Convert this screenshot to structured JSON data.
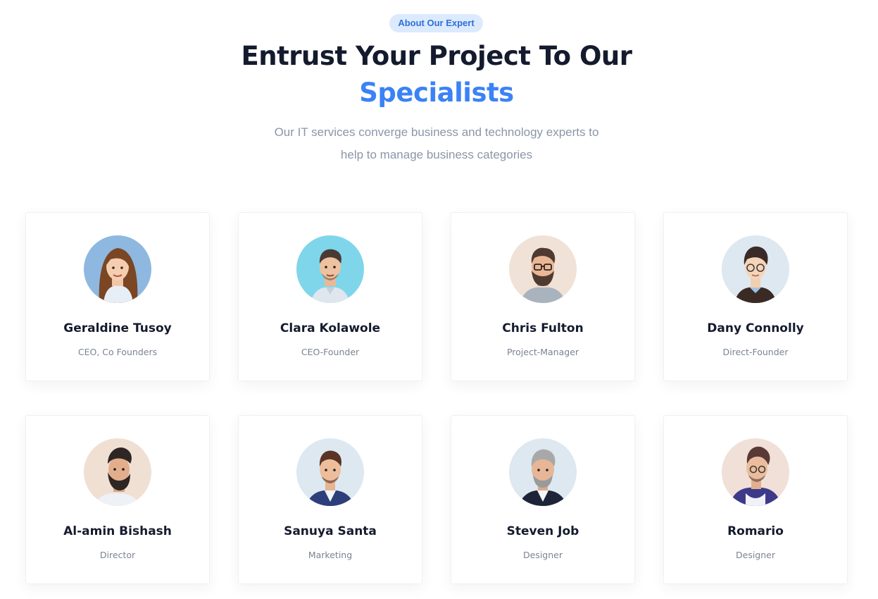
{
  "section": {
    "badge": "About Our Expert",
    "heading_line1": "Entrust Your Project To Our",
    "heading_line2": "Specialists",
    "subtitle_line1": "Our IT services converge business and technology experts to",
    "subtitle_line2": "help to manage business categories"
  },
  "colors": {
    "accent": "#3b82f6",
    "heading": "#151b2e",
    "muted": "#8b96a8",
    "badge_bg": "#dceafe"
  },
  "team": [
    {
      "name": "Geraldine Tusoy",
      "role": "CEO, Co Founders",
      "avatar_icon": "woman-long-hair-avatar",
      "avatar_bg": "#8fb8e0"
    },
    {
      "name": "Clara Kolawole",
      "role": "CEO-Founder",
      "avatar_icon": "man-shirt-avatar",
      "avatar_bg": "#7fd6ea"
    },
    {
      "name": "Chris Fulton",
      "role": "Project-Manager",
      "avatar_icon": "man-glasses-beard-avatar",
      "avatar_bg": "#f0e2d6"
    },
    {
      "name": "Dany Connolly",
      "role": "Direct-Founder",
      "avatar_icon": "man-glasses-sweater-avatar",
      "avatar_bg": "#dde8f0"
    },
    {
      "name": "Al-amin Bishash",
      "role": "Director",
      "avatar_icon": "man-beard-profile-avatar",
      "avatar_bg": "#f0e0d4"
    },
    {
      "name": "Sanuya Santa",
      "role": "Marketing",
      "avatar_icon": "man-suit-avatar",
      "avatar_bg": "#dde8f0"
    },
    {
      "name": "Steven Job",
      "role": "Designer",
      "avatar_icon": "older-man-suit-avatar",
      "avatar_bg": "#dde8f0"
    },
    {
      "name": "Romario",
      "role": "Designer",
      "avatar_icon": "man-hoodie-glasses-avatar",
      "avatar_bg": "#f0e0d8"
    }
  ]
}
